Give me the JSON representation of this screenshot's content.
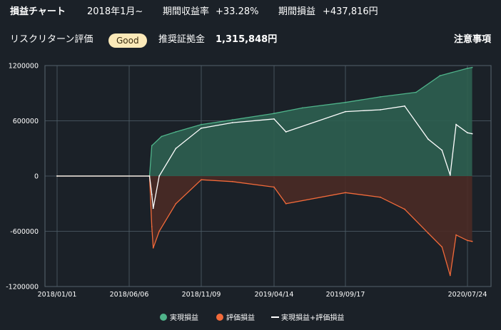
{
  "header": {
    "title": "損益チャート",
    "period": "2018年1月~",
    "return_label": "期間収益率",
    "return_value": "+33.28%",
    "pnl_label": "期間損益",
    "pnl_value": "+437,816円"
  },
  "risk": {
    "label": "リスクリターン評価",
    "badge": "Good",
    "deposit_label": "推奨証拠金",
    "deposit_value": "1,315,848円",
    "notice_link": "注意事項"
  },
  "colors": {
    "realized": "#4fb38a",
    "realized_fill": "#2e5f50",
    "unrealized": "#f26a3a",
    "unrealized_fill": "#4a2a25",
    "total": "#ffffff",
    "grid": "#52606b",
    "badge_bg": "#fbe9b8"
  },
  "chart_data": {
    "type": "area",
    "x_ticks": [
      "2018/01/01",
      "2018/06/06",
      "2018/11/09",
      "2019/04/14",
      "2019/09/17",
      "2020/07/24"
    ],
    "y_ticks": [
      "1200000",
      "600000",
      "0",
      "-600000",
      "-1200000"
    ],
    "ylim": [
      -1200000,
      1200000
    ],
    "grid": true,
    "legend_position": "bottom",
    "series": [
      {
        "name": "実現損益",
        "x": [
          "2018/01/01",
          "2018/07/20",
          "2018/07/25",
          "2018/08/15",
          "2018/09/15",
          "2018/11/09",
          "2019/01/15",
          "2019/04/14",
          "2019/06/15",
          "2019/09/17",
          "2019/12/15",
          "2020/03/15",
          "2020/05/15",
          "2020/07/24",
          "2020/08/05"
        ],
        "values": [
          0,
          0,
          330000,
          430000,
          480000,
          560000,
          610000,
          680000,
          740000,
          800000,
          860000,
          910000,
          1090000,
          1170000,
          1180000
        ]
      },
      {
        "name": "評価損益",
        "x": [
          "2018/01/01",
          "2018/07/20",
          "2018/07/25",
          "2018/07/28",
          "2018/08/10",
          "2018/09/15",
          "2018/11/09",
          "2019/01/15",
          "2019/04/14",
          "2019/05/10",
          "2019/09/17",
          "2019/12/15",
          "2020/02/15",
          "2020/04/15",
          "2020/05/20",
          "2020/06/10",
          "2020/06/25",
          "2020/07/24",
          "2020/08/05"
        ],
        "values": [
          0,
          0,
          -550000,
          -780000,
          -600000,
          -300000,
          -40000,
          -60000,
          -120000,
          -300000,
          -180000,
          -230000,
          -360000,
          -620000,
          -770000,
          -1080000,
          -640000,
          -700000,
          -710000
        ]
      },
      {
        "name": "実現損益+評価損益",
        "x": [
          "2018/01/01",
          "2018/07/20",
          "2018/07/25",
          "2018/07/28",
          "2018/08/10",
          "2018/09/15",
          "2018/11/09",
          "2019/01/15",
          "2019/04/14",
          "2019/05/10",
          "2019/09/17",
          "2019/12/15",
          "2020/02/15",
          "2020/04/15",
          "2020/05/20",
          "2020/06/10",
          "2020/06/25",
          "2020/07/24",
          "2020/08/05"
        ],
        "values": [
          0,
          0,
          -200000,
          -350000,
          0,
          300000,
          520000,
          580000,
          620000,
          480000,
          700000,
          720000,
          760000,
          400000,
          280000,
          10000,
          560000,
          470000,
          460000
        ]
      }
    ]
  }
}
